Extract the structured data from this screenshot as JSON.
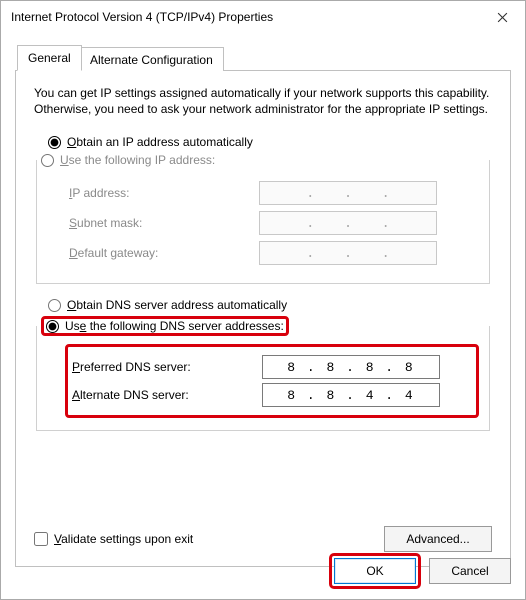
{
  "window": {
    "title": "Internet Protocol Version 4 (TCP/IPv4) Properties"
  },
  "tabs": {
    "general": "General",
    "alternate": "Alternate Configuration"
  },
  "intro": "You can get IP settings assigned automatically if your network supports this capability. Otherwise, you need to ask your network administrator for the appropriate IP settings.",
  "ip": {
    "auto_label_pre": "O",
    "auto_label_post": "btain an IP address automatically",
    "manual_label_pre": "U",
    "manual_label_post": "se the following IP address:",
    "addr_label_pre": "I",
    "addr_label_post": "P address:",
    "mask_label_pre": "S",
    "mask_label_post": "ubnet mask:",
    "gw_label_pre": "D",
    "gw_label_post": "efault gateway:",
    "addr_value": "",
    "mask_value": "",
    "gw_value": ""
  },
  "dns": {
    "auto_label_pre": "O",
    "auto_label_post": "btain DNS server address automatically",
    "manual_label_pre": "Us",
    "manual_label_post": "e the following DNS server addresses:",
    "pref_label_pre": "P",
    "pref_label_post": "referred DNS server:",
    "alt_label_pre": "A",
    "alt_label_post": "lternate DNS server:",
    "pref_value": "8 . 8 . 8 . 8",
    "alt_value": "8 . 8 . 4 . 4"
  },
  "validate_label_pre": "V",
  "validate_label_post": "alidate settings upon exit",
  "buttons": {
    "advanced": "Advanced...",
    "ok": "OK",
    "cancel": "Cancel"
  }
}
